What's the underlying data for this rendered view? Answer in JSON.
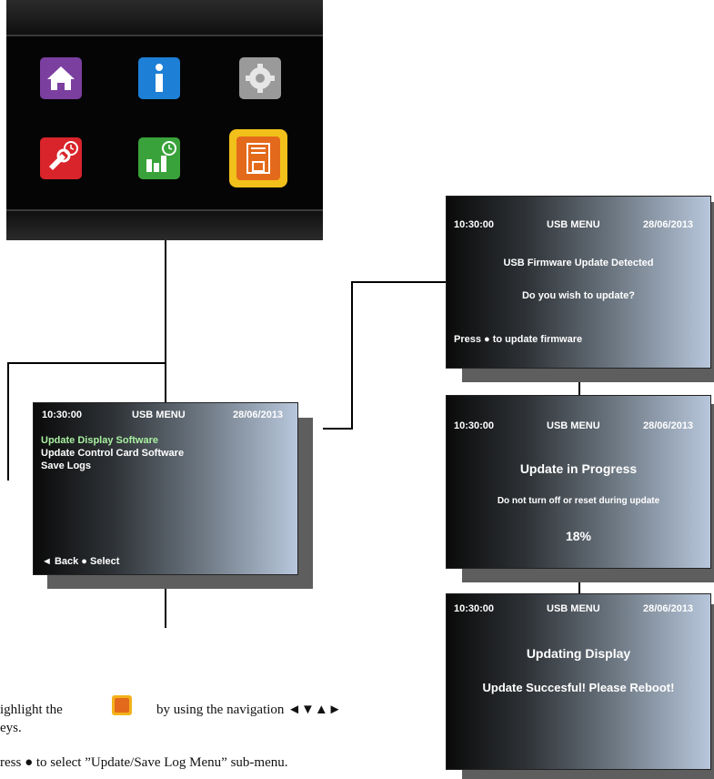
{
  "icon_menu": {
    "icons": [
      {
        "name": "home-icon",
        "color": "#7b3fa0"
      },
      {
        "name": "info-icon",
        "color": "#1d7fd6"
      },
      {
        "name": "settings-gear-icon",
        "color": "#9a9a9a"
      },
      {
        "name": "service-wrench-clock-icon",
        "color": "#d8242a"
      },
      {
        "name": "logs-chart-clock-icon",
        "color": "#3aa23a"
      },
      {
        "name": "save-floppy-icon",
        "color": "#e46a1b",
        "highlight": "#f2c01b"
      }
    ]
  },
  "screens": {
    "usb_menu": {
      "time": "10:30:00",
      "title": "USB MENU",
      "date": "28/06/2013",
      "items": [
        {
          "label": "Update Display Software",
          "selected": true
        },
        {
          "label": "Update Control Card Software",
          "selected": false
        },
        {
          "label": "Save Logs",
          "selected": false
        }
      ],
      "footer": "◄ Back  ● Select"
    },
    "update_detected": {
      "time": "10:30:00",
      "title": "USB MENU",
      "date": "28/06/2013",
      "line1": "USB Firmware Update Detected",
      "line2": "Do you wish to update?",
      "footer": "Press ● to update firmware"
    },
    "in_progress": {
      "time": "10:30:00",
      "title": "USB MENU",
      "date": "28/06/2013",
      "heading": "Update in Progress",
      "note": "Do not turn off or reset during update",
      "percent": "18%"
    },
    "done": {
      "time": "10:30:00",
      "title": "USB MENU",
      "date": "28/06/2013",
      "heading": "Updating Display",
      "message": "Update Succesful! Please Reboot!"
    }
  },
  "instructions": {
    "step1_before": "ighlight the",
    "step1_after": "by using the navigation ◄▼▲►",
    "step1_line2": "eys.",
    "step2": "ress ● to select ”Update/Save Log Menu” sub-menu."
  },
  "colors": {
    "selected_item": "#a8f0a0",
    "connector": "#000000",
    "screen_shadow": "#5e5e5e"
  }
}
